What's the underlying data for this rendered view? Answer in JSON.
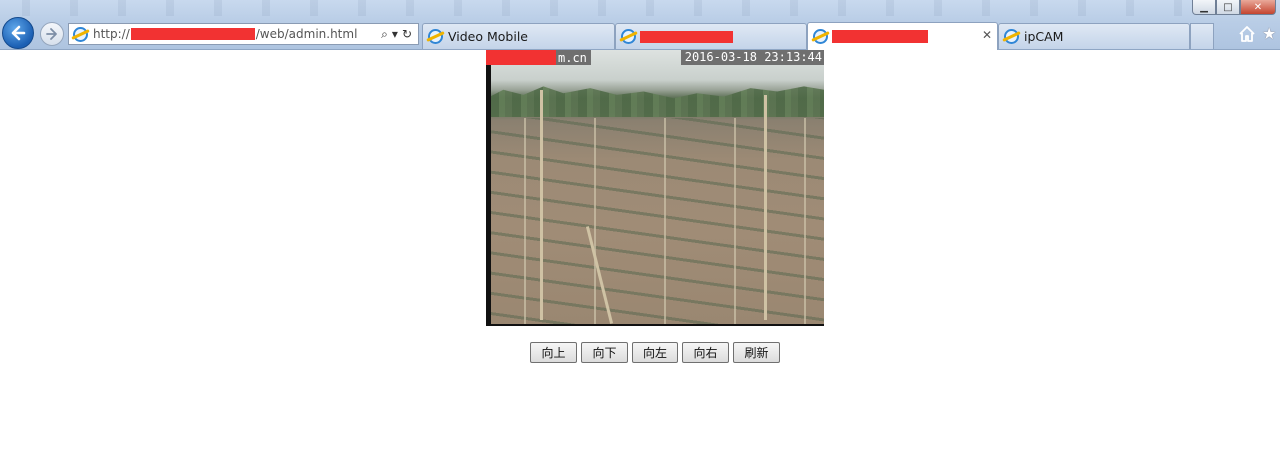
{
  "browser": {
    "address": {
      "url_prefix": "http://",
      "url_suffix": "/web/admin.html",
      "search_glyph": "⌕",
      "dropdown_glyph": "▾",
      "refresh_glyph": "↻"
    },
    "tabs": [
      {
        "label": "Video Mobile",
        "redacted": false,
        "active": false
      },
      {
        "label": "",
        "redacted": true,
        "active": false
      },
      {
        "label": "",
        "redacted": true,
        "active": true,
        "close_glyph": "✕"
      },
      {
        "label": "ipCAM",
        "redacted": false,
        "active": false
      }
    ],
    "window_controls": {
      "minimize": "▁",
      "maximize": "□",
      "close": "✕"
    },
    "icons": [
      "back-arrow-icon",
      "forward-arrow-icon",
      "ie-logo-icon",
      "home-icon",
      "favorites-star-icon"
    ],
    "star_glyph": "★",
    "redaction_color": "#f23232"
  },
  "camera": {
    "osd_name_suffix": "m.cn",
    "osd_timestamp": "2016-03-18 23:13:44"
  },
  "controls": {
    "up": "向上",
    "down": "向下",
    "left": "向左",
    "right": "向右",
    "refresh": "刷新"
  }
}
